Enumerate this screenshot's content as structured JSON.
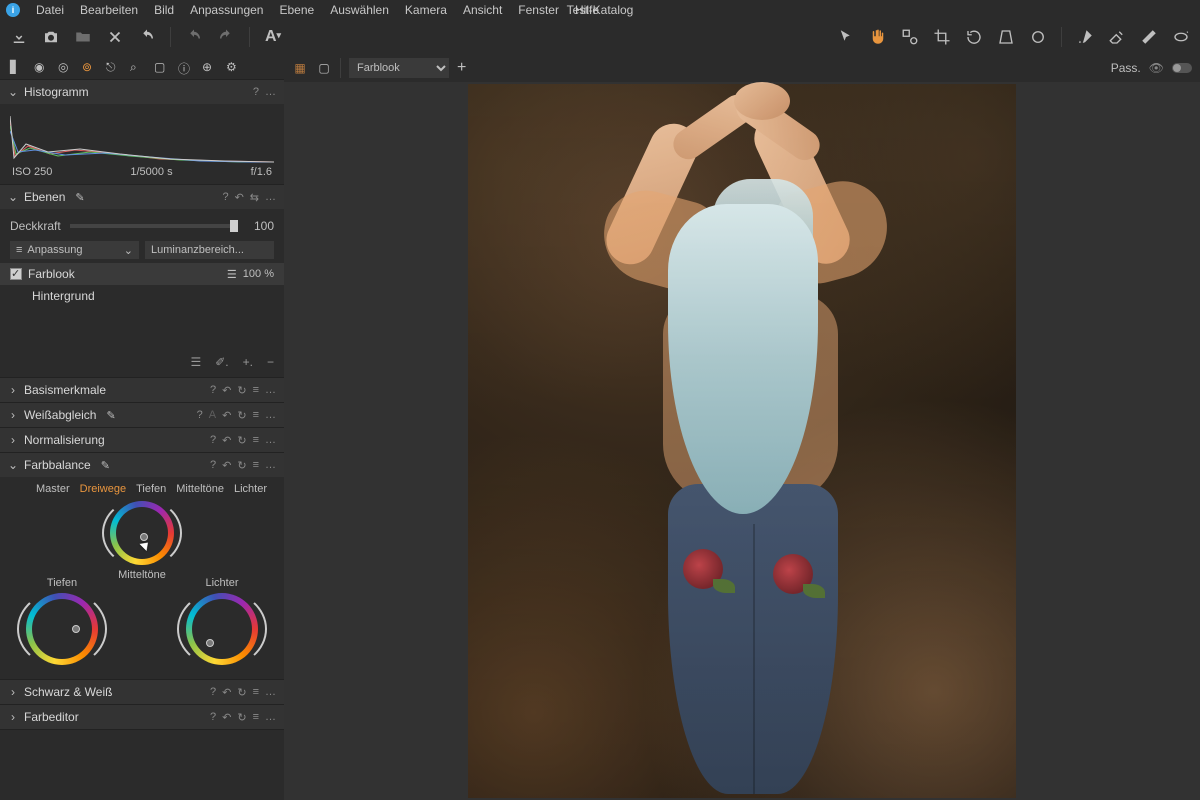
{
  "app": {
    "title": "Test-Katalog"
  },
  "menu": {
    "file": "Datei",
    "edit": "Bearbeiten",
    "image": "Bild",
    "adjust": "Anpassungen",
    "layer": "Ebene",
    "select": "Auswählen",
    "camera": "Kamera",
    "view": "Ansicht",
    "window": "Fenster",
    "help": "Hilfe"
  },
  "viewer": {
    "dropdown": "Farblook",
    "pass_label": "Pass."
  },
  "histogram": {
    "title": "Histogramm",
    "iso": "ISO 250",
    "shutter": "1/5000 s",
    "aperture": "f/1.6"
  },
  "layers": {
    "title": "Ebenen",
    "opacity_label": "Deckkraft",
    "opacity_value": "100",
    "mode_label": "Anpassung",
    "luma_label": "Luminanzbereich...",
    "item_farblook": "Farblook",
    "item_farblook_pct": "100 %",
    "item_background": "Hintergrund"
  },
  "sections": {
    "basic": "Basismerkmale",
    "whitebalance": "Weißabgleich",
    "normalize": "Normalisierung",
    "colorbalance": "Farbbalance",
    "bw": "Schwarz & Weiß",
    "coloreditor": "Farbeditor"
  },
  "colorbalance": {
    "tabs": {
      "master": "Master",
      "dreiwege": "Dreiwege",
      "tiefen": "Tiefen",
      "mitten": "Mitteltöne",
      "lichter": "Lichter"
    },
    "labels": {
      "tiefen": "Tiefen",
      "mitten": "Mitteltöne",
      "lichter": "Lichter"
    }
  },
  "glyphs": {
    "help": "?",
    "dots": "…",
    "reset": "↶",
    "arrow_cycle": "↻",
    "copy": "⇆",
    "chev_right": "›",
    "chev_down": "⌄",
    "pencil": "✎",
    "text_a": "A",
    "sliders": "☰",
    "brush": "✐",
    "plus": "+",
    "minus": "−"
  }
}
